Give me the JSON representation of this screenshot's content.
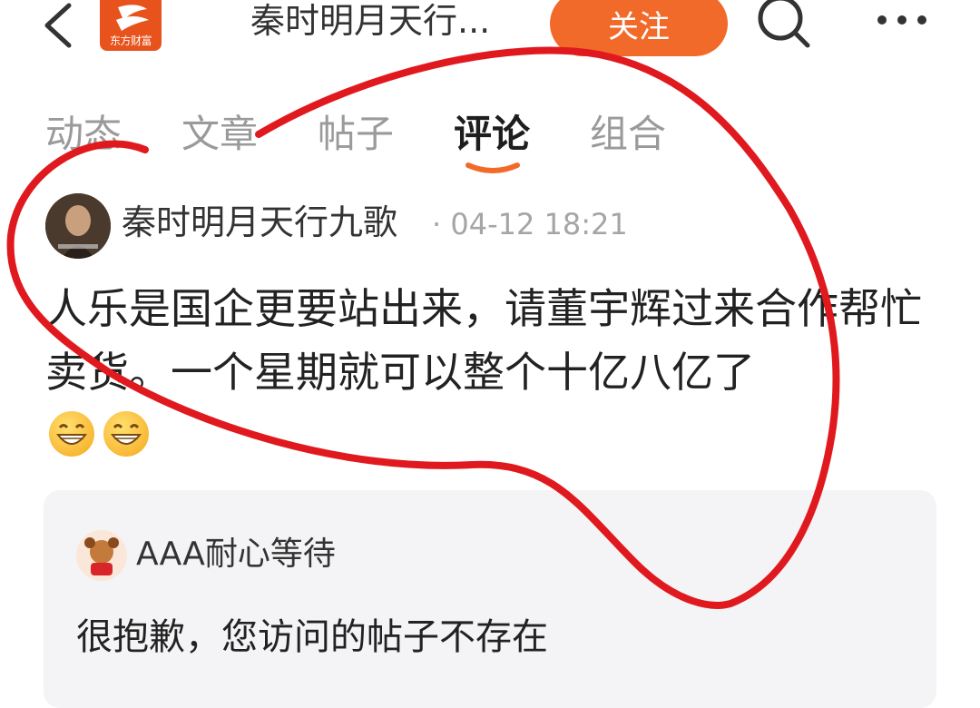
{
  "header": {
    "logo_text": "东方财富",
    "title": "秦时明月天行...",
    "follow_label": "关注"
  },
  "tabs": [
    {
      "label": "动态"
    },
    {
      "label": "文章"
    },
    {
      "label": "帖子"
    },
    {
      "label": "评论",
      "active": true
    },
    {
      "label": "组合"
    }
  ],
  "post": {
    "author": "秦时明月天行九歌",
    "time": "· 04-12 18:21",
    "content": "人乐是国企更要站出来，请董宇辉过来合作帮忙卖货。一个星期就可以整个十亿八亿了",
    "emojis": [
      "grin-emoji",
      "grin-emoji"
    ]
  },
  "quoted": {
    "author": "AAA耐心等待",
    "content": "很抱歉，您访问的帖子不存在"
  },
  "colors": {
    "accent": "#f26a2a",
    "logo": "#e8531d",
    "annotation": "#e0191e",
    "card_bg": "#f4f4f6"
  },
  "icons": [
    "back-arrow-icon",
    "search-icon",
    "more-dots-icon"
  ]
}
